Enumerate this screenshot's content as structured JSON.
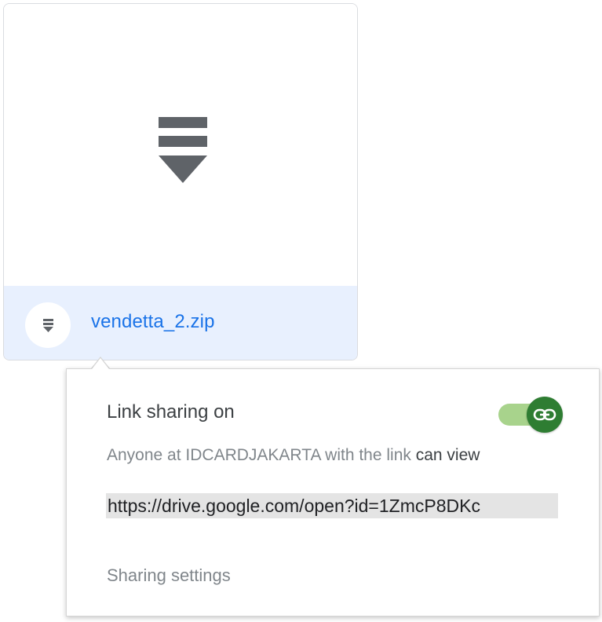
{
  "file": {
    "name": "vendetta_2.zip",
    "preview_icon": "zip-file-icon",
    "type_badge_icon": "zip-badge-icon"
  },
  "share": {
    "title": "Link sharing on",
    "toggle_state": "on",
    "toggle_icon": "link-icon",
    "description_prefix": "Anyone at IDCARDJAKARTA with the link",
    "permission": "can view",
    "link": "https://drive.google.com/open?id=1ZmcP8DKc",
    "settings_label": "Sharing settings"
  },
  "colors": {
    "accent_blue": "#1a73e8",
    "footer_bg": "#e8f0fe",
    "toggle_track": "#a8d38c",
    "toggle_thumb": "#2e7d32"
  }
}
